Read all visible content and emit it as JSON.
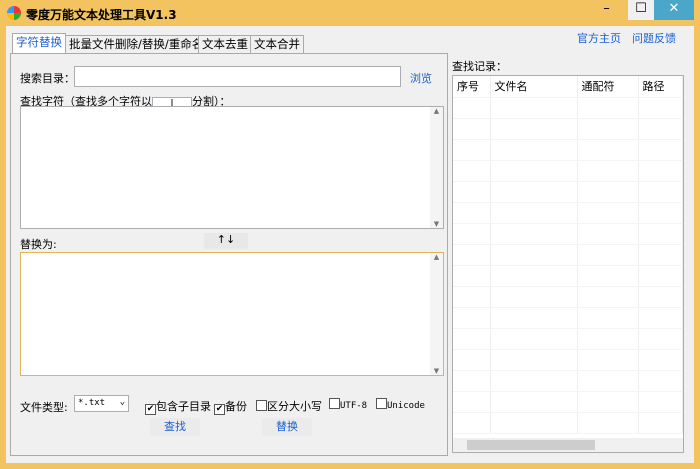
{
  "window": {
    "title": "零度万能文本处理工具V1.3",
    "minimize": "–",
    "maximize": "☐",
    "close": "✕"
  },
  "tabs": [
    "字符替换",
    "批量文件删除/替换/重命名",
    "文本去重",
    "文本合并"
  ],
  "links": {
    "home": "官方主页",
    "feedback": "问题反馈"
  },
  "form": {
    "search_dir_label": "搜索目录：",
    "search_dir_value": "",
    "browse": "浏览",
    "find_label_pre": "查找字符（查找多个字符以",
    "separator": "|",
    "find_label_post": "分割）：",
    "replace_label": "替换为:",
    "swap": "↑↓",
    "file_type_label": "文件类型:",
    "file_type_value": "*.txt",
    "options": [
      {
        "label": "包含子目录",
        "checked": true
      },
      {
        "label": "备份",
        "checked": true
      },
      {
        "label": "区分大小写",
        "checked": false
      },
      {
        "label": "UTF-8",
        "checked": false
      },
      {
        "label": "Unicode",
        "checked": false
      }
    ],
    "find_button": "查找",
    "replace_button": "替换"
  },
  "results": {
    "label": "查找记录：",
    "columns": [
      "序号",
      "文件名",
      "通配符",
      "路径"
    ]
  }
}
